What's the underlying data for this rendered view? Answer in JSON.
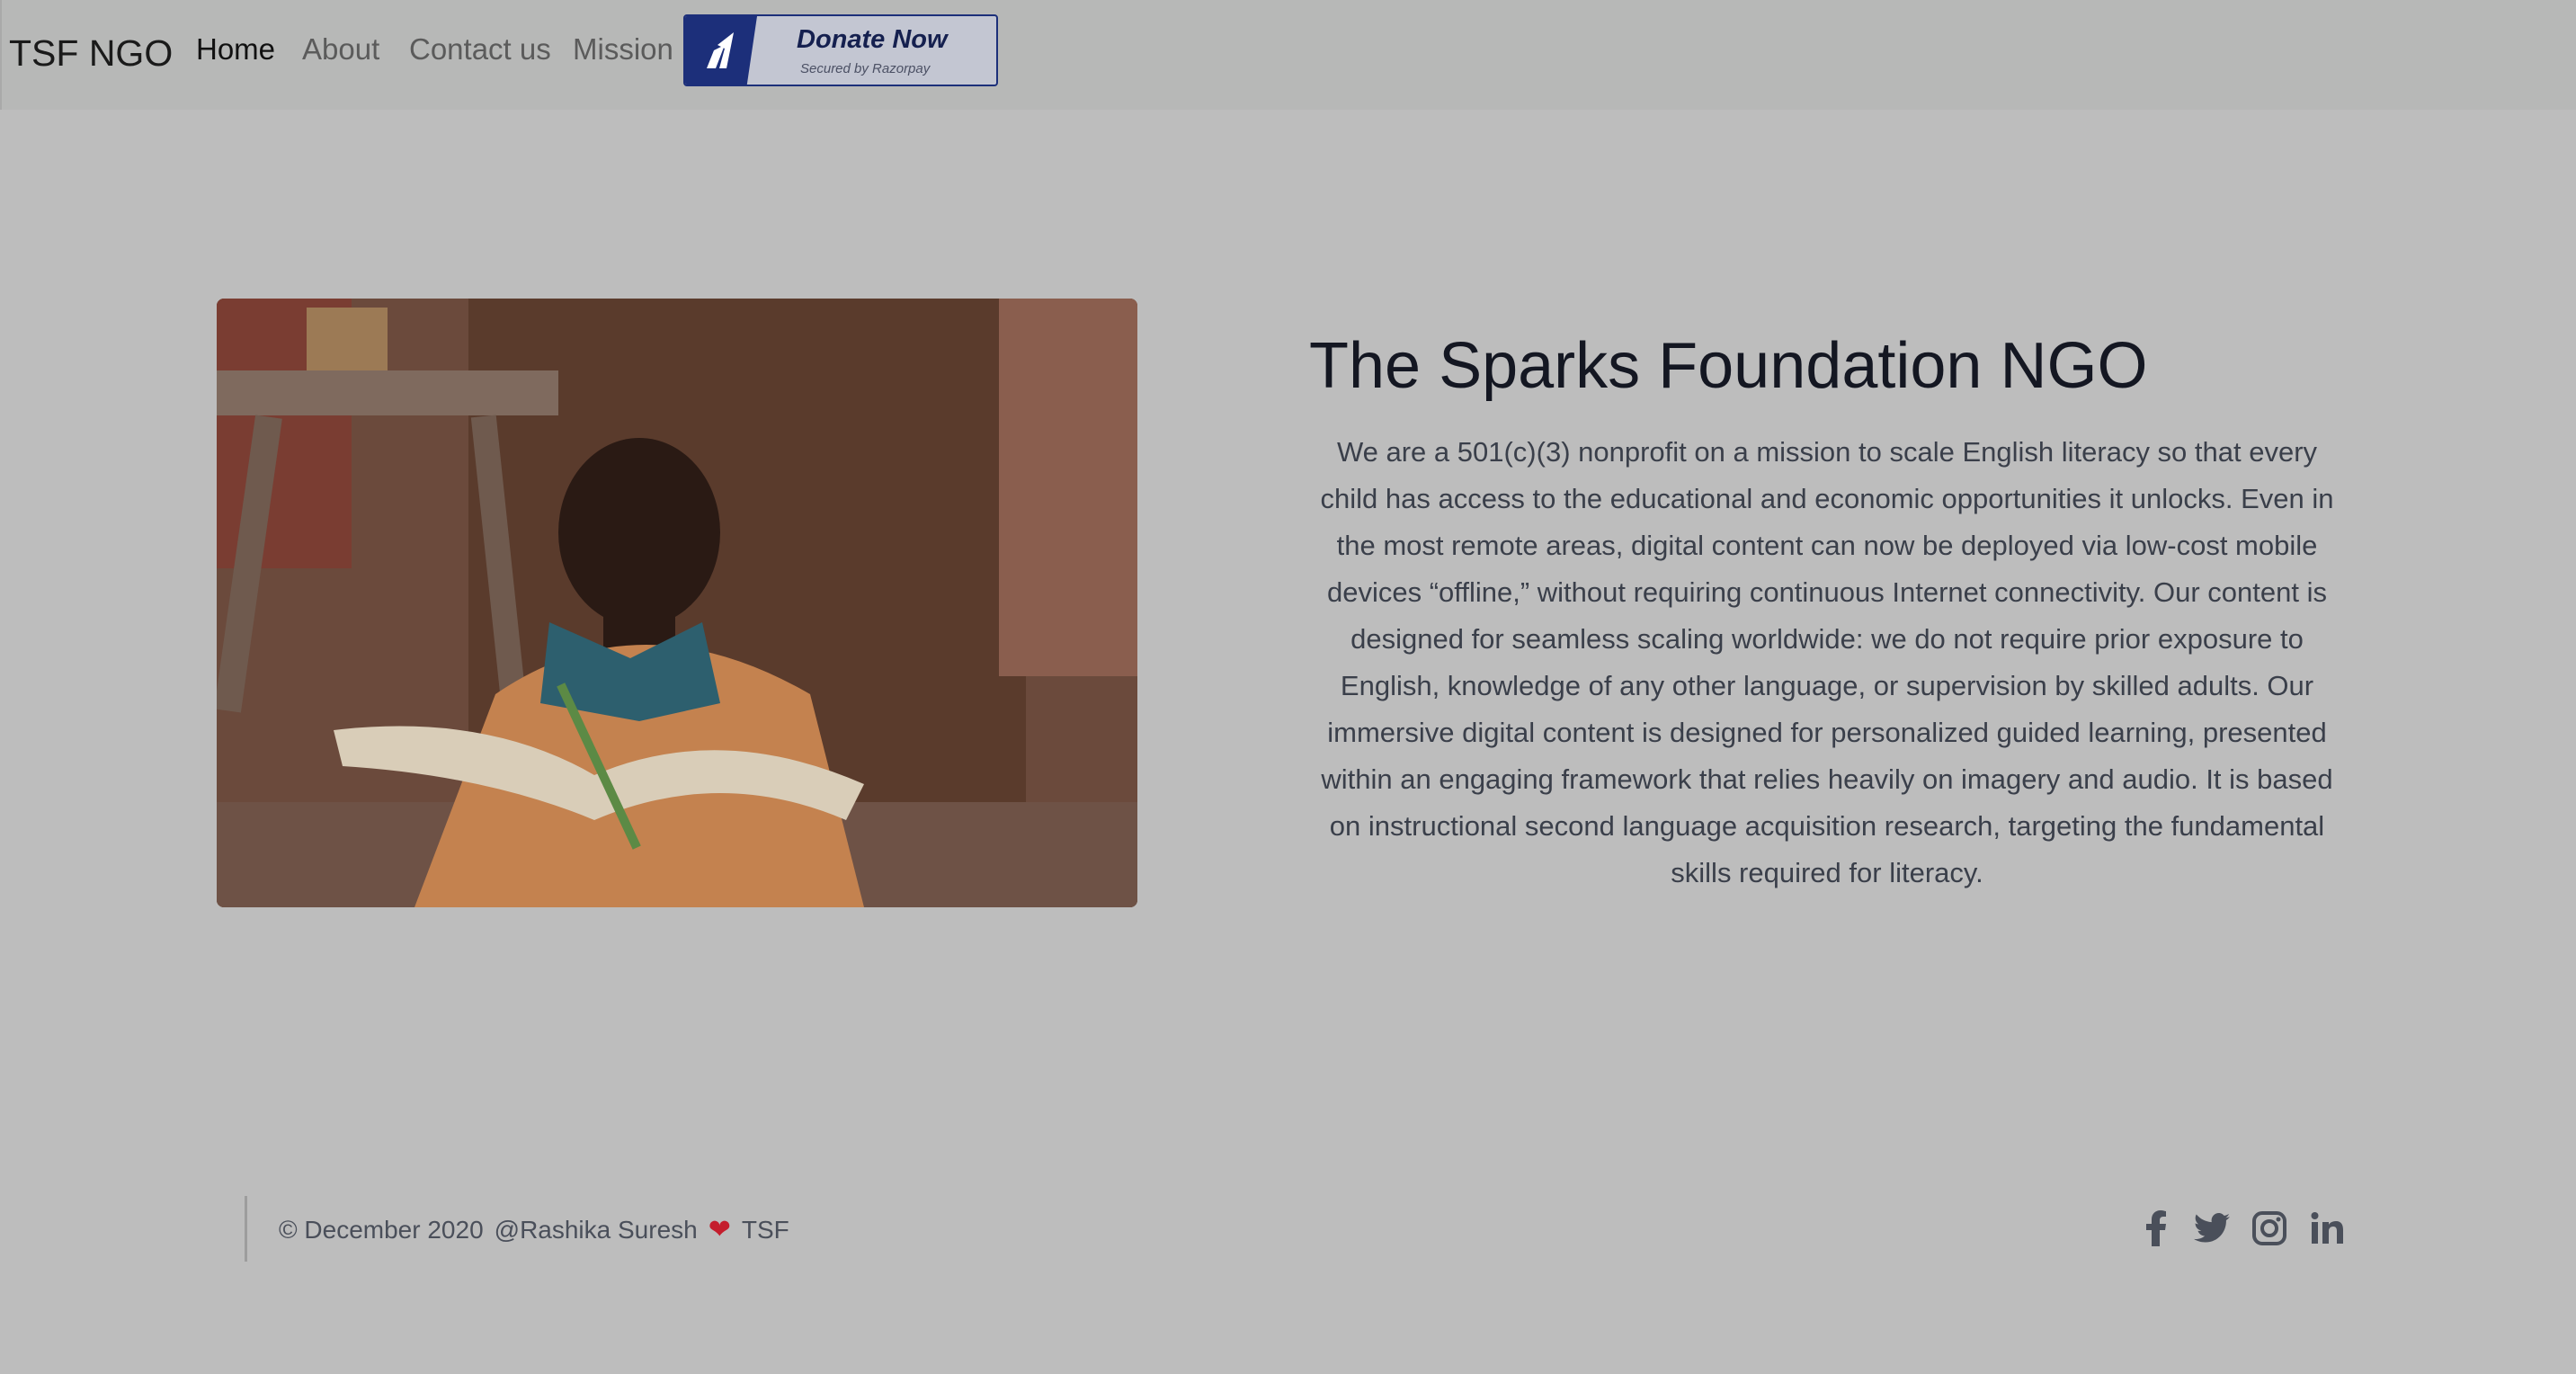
{
  "nav": {
    "brand": "TSF NGO",
    "links": [
      "Home",
      "About",
      "Contact us",
      "Mission"
    ],
    "donate": {
      "title": "Donate Now",
      "subtitle": "Secured by Razorpay"
    }
  },
  "hero": {
    "image_icon": "boy-reading-photo",
    "title": "The Sparks Foundation NGO",
    "description": "We are a 501(c)(3) nonprofit on a mission to scale English literacy so that every child has access to the educational and economic opportunities it unlocks. Even in the most remote areas, digital content can now be deployed via low-cost mobile devices “offline,” without requiring continuous Internet connectivity. Our content is designed for seamless scaling worldwide: we do not require prior exposure to English, knowledge of any other language, or supervision by skilled adults. Our immersive digital content is designed for personalized guided learning, presented within an engaging framework that relies heavily on imagery and audio. It is based on instructional second language acquisition research, targeting the fundamental skills required for literacy."
  },
  "footer": {
    "copyright": "© December 2020",
    "author": "@Rashika Suresh",
    "heart_icon": "heart-icon",
    "org": "TSF",
    "social_icons": [
      "facebook-icon",
      "twitter-icon",
      "instagram-icon",
      "linkedin-icon"
    ]
  },
  "colors": {
    "page_bg": "#bdbdbd",
    "navbar_bg": "#b7b8b7",
    "donate_blue": "#1c2f7a",
    "heart_red": "#c41e2d"
  }
}
